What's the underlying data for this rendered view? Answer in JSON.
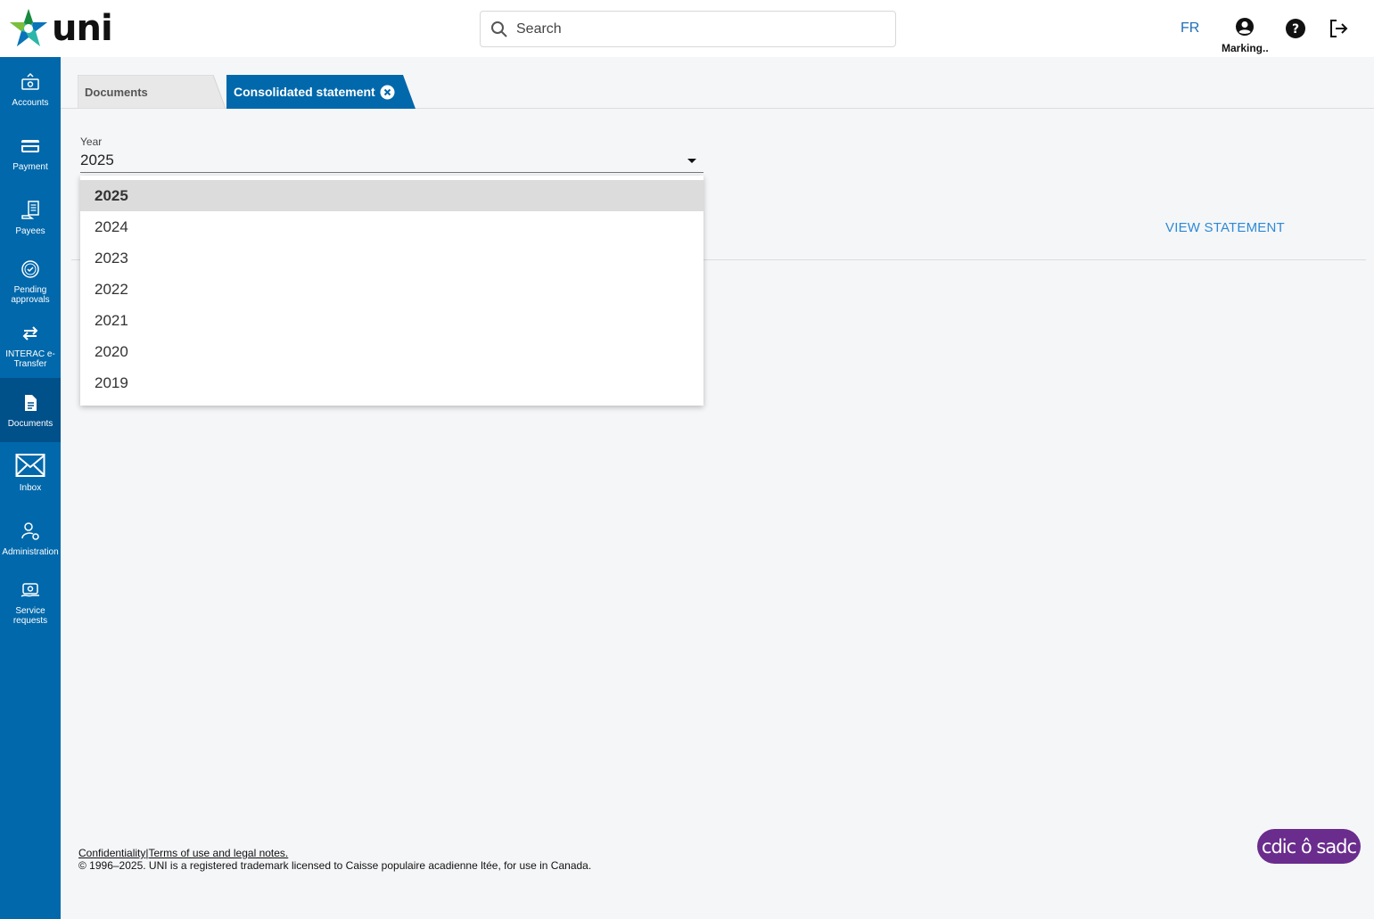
{
  "header": {
    "logo_text": "uni",
    "search_placeholder": "Search",
    "language": "FR",
    "user_name": "Marking..",
    "help_icon": "help-icon",
    "logout_icon": "logout-icon"
  },
  "sidebar": {
    "items": [
      {
        "label": "Accounts",
        "icon": "accounts-icon"
      },
      {
        "label": "Payment",
        "icon": "card-icon"
      },
      {
        "label": "Payees",
        "icon": "payees-icon"
      },
      {
        "label": "Pending approvals",
        "icon": "badge-check-icon"
      },
      {
        "label": "INTERAC e-Transfer",
        "icon": "transfer-arrows-icon"
      },
      {
        "label": "Documents",
        "icon": "document-icon",
        "active": true
      },
      {
        "label": "Inbox",
        "icon": "envelope-icon"
      },
      {
        "label": "Administration",
        "icon": "user-gear-icon"
      },
      {
        "label": "Service requests",
        "icon": "service-icon"
      }
    ]
  },
  "tabs": [
    {
      "label": "Documents"
    },
    {
      "label": "Consolidated statement",
      "active": true
    }
  ],
  "year": {
    "label": "Year",
    "value": "2025",
    "options": [
      "2025",
      "2024",
      "2023",
      "2022",
      "2021",
      "2020",
      "2019"
    ]
  },
  "view_statement": "VIEW STATEMENT",
  "footer": {
    "confidentiality": "Confidentiality",
    "separator": "|",
    "terms": "Terms of use and legal notes.",
    "copyright": "© 1996–2025. UNI is a registered trademark licensed to Caisse populaire acadienne ltée, for use in Canada.",
    "cdic": "cdic ô sadc"
  },
  "colors": {
    "sidebar": "#0068ab",
    "sidebar_active": "#00508a",
    "link": "#2d8ad6",
    "cdic": "#6a2c8d"
  }
}
